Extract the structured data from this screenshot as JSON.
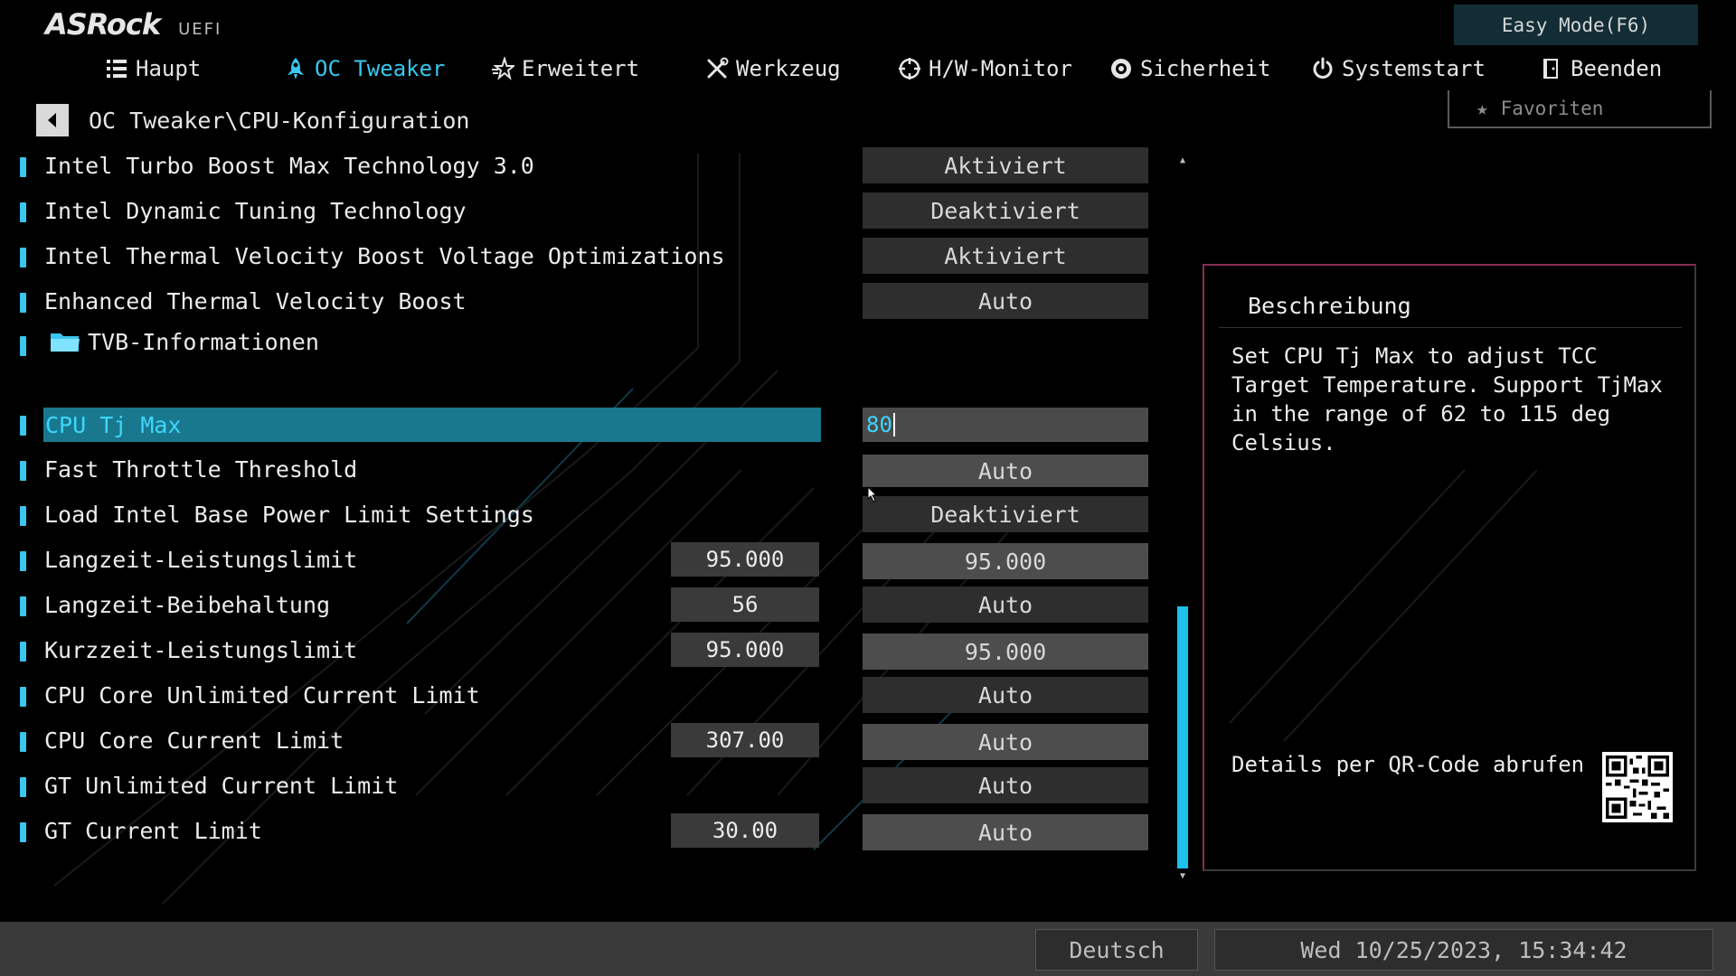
{
  "header": {
    "brand": "ASRock",
    "sub": "UEFI",
    "easy_mode": "Easy Mode(F6)",
    "favorites": "Favoriten"
  },
  "nav": {
    "items": [
      {
        "label": "Haupt",
        "icon": "list-icon"
      },
      {
        "label": "OC Tweaker",
        "icon": "rocket-icon",
        "active": true
      },
      {
        "label": "Erweitert",
        "icon": "star-advanced-icon"
      },
      {
        "label": "Werkzeug",
        "icon": "tools-icon"
      },
      {
        "label": "H/W-Monitor",
        "icon": "crosshair-monitor-icon"
      },
      {
        "label": "Sicherheit",
        "icon": "shield-gear-icon"
      },
      {
        "label": "Systemstart",
        "icon": "power-icon"
      },
      {
        "label": "Beenden",
        "icon": "exit-door-icon"
      }
    ]
  },
  "breadcrumb": "OC Tweaker\\CPU-Konfiguration",
  "rows": [
    {
      "label": "Intel Turbo Boost Max Technology 3.0",
      "option": "Aktiviert"
    },
    {
      "label": "Intel Dynamic Tuning Technology",
      "option": "Deaktiviert"
    },
    {
      "label": "Intel Thermal Velocity Boost Voltage Optimizations",
      "option": "Aktiviert"
    },
    {
      "label": "Enhanced Thermal Velocity Boost",
      "option": "Auto"
    },
    {
      "label": "TVB-Informationen"
    },
    {
      "label": "CPU Tj Max",
      "input_value": "80"
    },
    {
      "label": "Fast Throttle Threshold",
      "option": "Auto"
    },
    {
      "label": "Load Intel Base Power Limit Settings",
      "option": "Deaktiviert"
    },
    {
      "label": "Langzeit-Leistungslimit",
      "current": "95.000",
      "option": "95.000"
    },
    {
      "label": "Langzeit-Beibehaltung",
      "current": "56",
      "option": "Auto"
    },
    {
      "label": "Kurzzeit-Leistungslimit",
      "current": "95.000",
      "option": "95.000"
    },
    {
      "label": "CPU Core Unlimited Current Limit",
      "option": "Auto"
    },
    {
      "label": "CPU Core Current Limit",
      "current": "307.00",
      "option": "Auto"
    },
    {
      "label": "GT Unlimited Current Limit",
      "option": "Auto"
    },
    {
      "label": "GT Current Limit",
      "current": "30.00",
      "option": "Auto"
    }
  ],
  "description": {
    "title": "Beschreibung",
    "text": "Set CPU Tj Max to adjust TCC Target Temperature. Support TjMax in the range of 62 to 115 deg Celsius.",
    "qr_label": "Details per QR-Code abrufen"
  },
  "footer": {
    "language": "Deutsch",
    "datetime": "Wed 10/25/2023, 15:34:42"
  },
  "colors": {
    "accent": "#3ac6ee",
    "selected_row": "#19788d",
    "scroll_thumb": "#1ec0ec"
  }
}
